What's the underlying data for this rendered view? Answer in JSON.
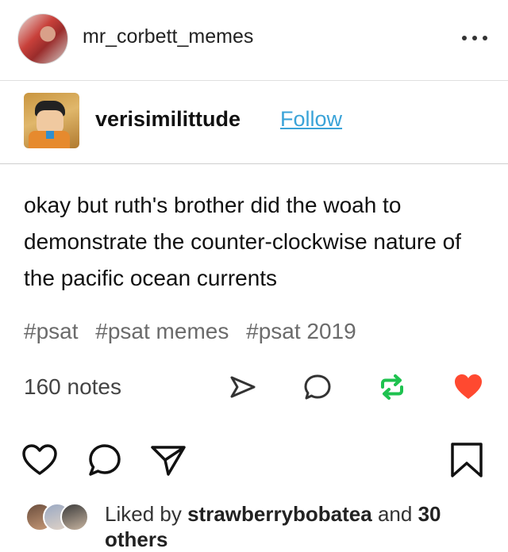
{
  "header": {
    "username": "mr_corbett_memes",
    "avatar_icon": "profile-photo",
    "more_icon": "ellipsis-icon"
  },
  "reblog": {
    "blog_name": "verisimilittude",
    "follow_label": "Follow",
    "follow_color": "#3aa3d8"
  },
  "post": {
    "text": "okay but ruth's brother did the woah to demonstrate the counter-clockwise nature of the pacific ocean currents",
    "tags": [
      "#psat",
      "#psat memes",
      "#psat 2019"
    ]
  },
  "actions": {
    "notes_label": "160 notes",
    "share_icon": "send-icon",
    "reply_icon": "comment-icon",
    "reblog_icon": "reblog-icon",
    "like_icon": "heart-icon",
    "reblog_color": "#1ec24f",
    "like_color": "#ff4930"
  },
  "instagram": {
    "like_icon": "heart-outline-icon",
    "comment_icon": "comment-outline-icon",
    "share_icon": "paper-plane-icon",
    "save_icon": "bookmark-icon",
    "liked_prefix": "Liked by",
    "liked_user": "strawberrybobatea",
    "liked_and": "and",
    "liked_count": "30",
    "liked_suffix": "others"
  }
}
